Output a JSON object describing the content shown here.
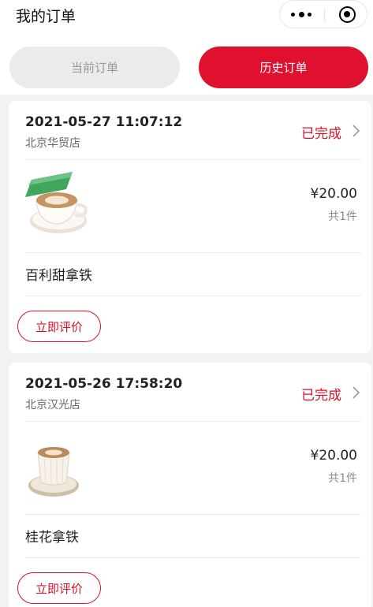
{
  "header": {
    "title": "我的订单"
  },
  "tabs": {
    "current": "当前订单",
    "history": "历史订单"
  },
  "orders": [
    {
      "datetime": "2021-05-27 11:07:12",
      "store": "北京华贸店",
      "status": "已完成",
      "price": "¥20.00",
      "quantity": "共1件",
      "product": "百利甜拿铁",
      "action": "立即评价"
    },
    {
      "datetime": "2021-05-26 17:58:20",
      "store": "北京汉光店",
      "status": "已完成",
      "price": "¥20.00",
      "quantity": "共1件",
      "product": "桂花拿铁",
      "action": "立即评价"
    }
  ],
  "colors": {
    "accent": "#e0112f",
    "status": "#d6132a",
    "background": "#f2f2f2"
  }
}
